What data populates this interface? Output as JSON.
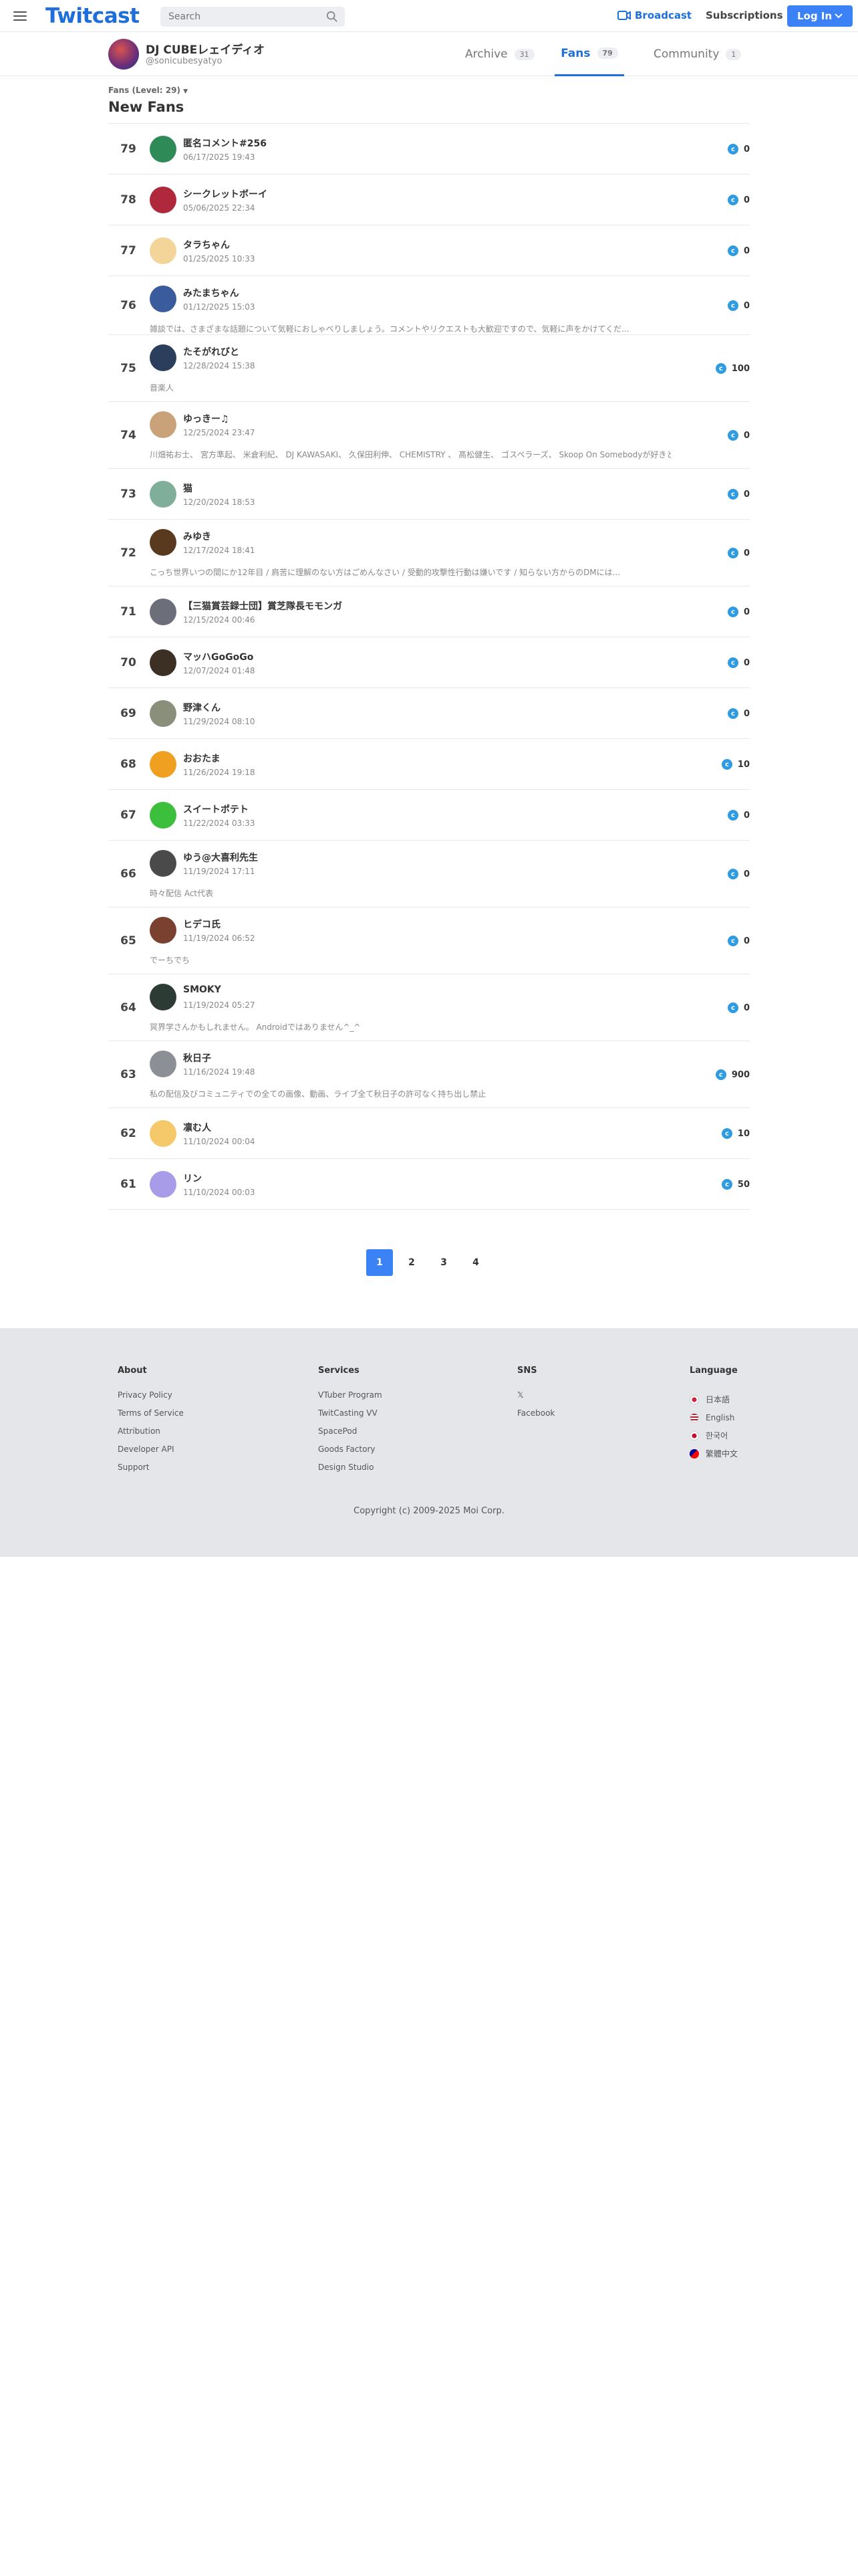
{
  "header": {
    "logo": "Twitcast",
    "search_placeholder": "Search",
    "broadcast": "Broadcast",
    "subscriptions": "Subscriptions",
    "login": "Log In"
  },
  "profile": {
    "name": "DJ CUBEレェイディオ",
    "handle": "@sonicubesyatyo",
    "tabs": [
      {
        "label": "Archive",
        "count": "31"
      },
      {
        "label": "Fans",
        "count": "79"
      },
      {
        "label": "Community",
        "count": "1"
      }
    ]
  },
  "fans": {
    "level_label": "Fans (Level: 29)",
    "heading": "New Fans",
    "rows": [
      {
        "rank": "79",
        "name": "匿名コメント#256",
        "date": "06/17/2025 19:43",
        "bio": "",
        "points": "0",
        "av": "#2e8b57"
      },
      {
        "rank": "78",
        "name": "シークレットボーイ",
        "date": "05/06/2025 22:34",
        "bio": "",
        "points": "0",
        "av": "#b0283b"
      },
      {
        "rank": "77",
        "name": "タラちゃん",
        "date": "01/25/2025 10:33",
        "bio": "",
        "points": "0",
        "av": "#f3d59a"
      },
      {
        "rank": "76",
        "name": "みたまちゃん",
        "date": "01/12/2025 15:03",
        "bio": "雑談では、さまざまな話題について気軽におしゃべりしましょう。コメントやリクエストも大歓迎ですので、気軽に声をかけてくだ...",
        "points": "0",
        "av": "#3a5b9c"
      },
      {
        "rank": "75",
        "name": "たそがれびと",
        "date": "12/28/2024 15:38",
        "bio": "音楽人",
        "points": "100",
        "av": "#2b3f5c"
      },
      {
        "rank": "74",
        "name": "ゆっきー♫",
        "date": "12/25/2024 23:47",
        "bio": "川畑祐お士、 宮方準起、 米倉利紀、 DJ KAWASAKI、 久保田利伸、 CHEMISTRY 、 髙松健生、 ゴスペラーズ、 Skoop On Somebodyが好きと...",
        "points": "0",
        "av": "#c9a27a"
      },
      {
        "rank": "73",
        "name": "猫",
        "date": "12/20/2024 18:53",
        "bio": "",
        "points": "0",
        "av": "#7fae9a"
      },
      {
        "rank": "72",
        "name": "みゆき",
        "date": "12/17/2024 18:41",
        "bio": "こっち世界いつの間にか12年目 / 肩苦に理解のない方はごめんなさい / 受動的攻撃性行動は嫌いです / 知らない方からのDMには...",
        "points": "0",
        "av": "#5a3a1e"
      },
      {
        "rank": "71",
        "name": "【三猫賞芸録士団】賞芝隊長モモンガ",
        "date": "12/15/2024 00:46",
        "bio": "",
        "points": "0",
        "av": "#6c6f7a"
      },
      {
        "rank": "70",
        "name": "マッハGoGoGo",
        "date": "12/07/2024 01:48",
        "bio": "",
        "points": "0",
        "av": "#3c2f23"
      },
      {
        "rank": "69",
        "name": "野津くん",
        "date": "11/29/2024 08:10",
        "bio": "",
        "points": "0",
        "av": "#8a8f7c"
      },
      {
        "rank": "68",
        "name": "おおたま",
        "date": "11/26/2024 19:18",
        "bio": "",
        "points": "10",
        "av": "#f0a020"
      },
      {
        "rank": "67",
        "name": "スイートポテト",
        "date": "11/22/2024 03:33",
        "bio": "",
        "points": "0",
        "av": "#3cbf3c"
      },
      {
        "rank": "66",
        "name": "ゆう@大喜利先生",
        "date": "11/19/2024 17:11",
        "bio": "時々配信 Act代表",
        "points": "0",
        "av": "#4a4a4a"
      },
      {
        "rank": "65",
        "name": "ヒデコ氏",
        "date": "11/19/2024 06:52",
        "bio": "でーちでち",
        "points": "0",
        "av": "#7a4030"
      },
      {
        "rank": "64",
        "name": "SMOKY",
        "date": "11/19/2024 05:27",
        "bio": "冥界学さんかもしれません。 Androidではありません^_^",
        "points": "0",
        "av": "#2d3b35"
      },
      {
        "rank": "63",
        "name": "秋日子",
        "date": "11/16/2024 19:48",
        "bio": "私の配信及びコミュニティでの全ての画像、動画、ライブ全て秋日子の許可なく持ち出し禁止",
        "points": "900",
        "av": "#8d8f96"
      },
      {
        "rank": "62",
        "name": "凛む人",
        "date": "11/10/2024 00:04",
        "bio": "",
        "points": "10",
        "av": "#f5c96a"
      },
      {
        "rank": "61",
        "name": "リン",
        "date": "11/10/2024 00:03",
        "bio": "",
        "points": "50",
        "av": "#a89be8"
      }
    ]
  },
  "pagination": [
    "1",
    "2",
    "3",
    "4"
  ],
  "footer": {
    "about": {
      "title": "About",
      "links": [
        "Privacy Policy",
        "Terms of Service",
        "Attribution",
        "Developer API",
        "Support"
      ]
    },
    "services": {
      "title": "Services",
      "links": [
        "VTuber Program",
        "TwitCasting VV",
        "SpacePod",
        "Goods Factory",
        "Design Studio"
      ]
    },
    "sns": {
      "title": "SNS",
      "links": [
        "𝕏",
        "Facebook"
      ]
    },
    "language": {
      "title": "Language",
      "links": [
        "日本語",
        "English",
        "한국어",
        "繁體中文"
      ]
    },
    "copyright": "Copyright (c) 2009-2025 Moi Corp."
  }
}
